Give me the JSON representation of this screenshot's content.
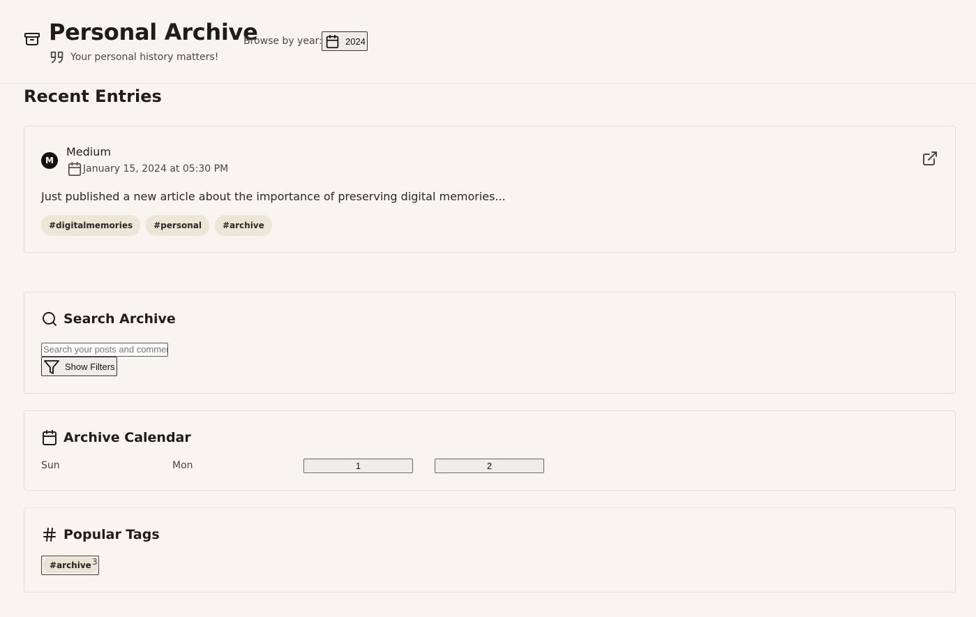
{
  "header": {
    "title": "Personal Archive",
    "tagline": "Your personal history matters!",
    "browse_label": "Browse by year:",
    "year": "2024"
  },
  "recent": {
    "title": "Recent Entries",
    "entries": [
      {
        "avatar_letter": "M",
        "source": "Medium",
        "date": "January 15, 2024 at 05:30 PM",
        "text": "Just published a new article about the importance of preserving digital memories...",
        "tags": [
          "#digitalmemories",
          "#personal",
          "#archive"
        ]
      }
    ]
  },
  "search": {
    "title": "Search Archive",
    "placeholder": "Search your posts and comments...",
    "filters_label": "Show Filters"
  },
  "calendar": {
    "title": "Archive Calendar",
    "day_headers": [
      "Sun",
      "Mon"
    ],
    "days": [
      "1",
      "2"
    ]
  },
  "popular_tags": {
    "title": "Popular Tags",
    "tags": [
      {
        "label": "#archive",
        "count": "3"
      }
    ]
  },
  "icons": {
    "header": "archive-box-icon",
    "tagline": "quote-icon",
    "year": "calendar-icon",
    "entry_date": "calendar-icon",
    "entry_link": "external-link-icon",
    "search": "search-icon",
    "filters": "filter-icon",
    "calendar": "calendar-icon",
    "tags": "hash-icon"
  }
}
